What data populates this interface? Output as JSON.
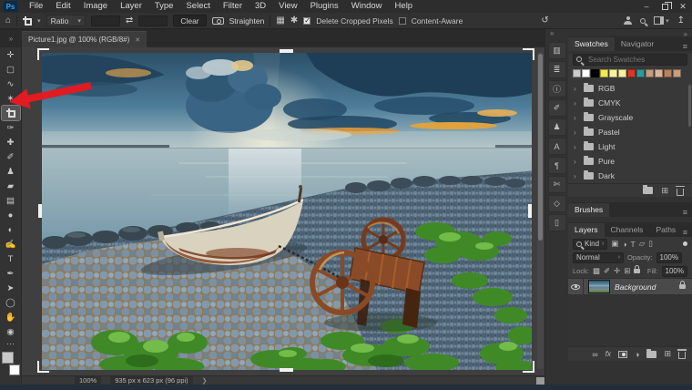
{
  "title_bar": {
    "logo": "Ps",
    "window_controls": {
      "minimize": "–",
      "restore": "",
      "close": "✕"
    }
  },
  "menu_bar": {
    "items": [
      "File",
      "Edit",
      "Image",
      "Layer",
      "Type",
      "Select",
      "Filter",
      "3D",
      "View",
      "Plugins",
      "Window",
      "Help"
    ]
  },
  "options_bar": {
    "home_icon": "⌂",
    "tool_caret": "▾",
    "ratio_value": "Ratio",
    "width_value": "",
    "swap_icon": "⇄",
    "height_value": "",
    "clear_label": "Clear",
    "straighten_label": "Straighten",
    "overlay_icon": "▦",
    "gear_icon": "✱",
    "delete_cropped_pixels_label": "Delete Cropped Pixels",
    "content_aware_label": "Content-Aware",
    "reset_icon": "↺",
    "share_icon": "↥"
  },
  "tab_bar": {
    "overflow_icon": "»",
    "doc_title": "Picture1.jpg @ 100% (RGB/8#)",
    "close_icon": "✕"
  },
  "toolbar": {
    "tools": [
      {
        "name": "move-tool",
        "glyph": "✛"
      },
      {
        "name": "marquee-tool",
        "glyph": "▢"
      },
      {
        "name": "lasso-tool",
        "glyph": "∿"
      },
      {
        "name": "quick-selection-tool",
        "glyph": "✶"
      },
      {
        "name": "crop-tool",
        "glyph": ""
      },
      {
        "name": "eyedropper-tool",
        "glyph": "✑"
      },
      {
        "name": "healing-brush-tool",
        "glyph": "✚"
      },
      {
        "name": "brush-tool",
        "glyph": "✐"
      },
      {
        "name": "clone-stamp-tool",
        "glyph": "♟"
      },
      {
        "name": "eraser-tool",
        "glyph": "▰"
      },
      {
        "name": "gradient-tool",
        "glyph": "▤"
      },
      {
        "name": "blur-tool",
        "glyph": "●"
      },
      {
        "name": "dodge-tool",
        "glyph": "◐"
      },
      {
        "name": "smudge-tool",
        "glyph": "✍"
      },
      {
        "name": "type-tool",
        "glyph": "T"
      },
      {
        "name": "pen-tool",
        "glyph": "✒"
      },
      {
        "name": "path-select-tool",
        "glyph": "➤"
      },
      {
        "name": "shape-tool",
        "glyph": "◯"
      },
      {
        "name": "hand-tool",
        "glyph": "✋"
      },
      {
        "name": "zoom-tool",
        "glyph": "◉"
      }
    ],
    "more_icon": "⋯"
  },
  "dock": {
    "collapse_icon": "«",
    "icons": [
      {
        "name": "histogram",
        "glyph": "▥"
      },
      {
        "name": "adjustments",
        "glyph": "≣"
      },
      {
        "name": "info",
        "glyph": "ⓘ"
      },
      {
        "name": "brush-settings",
        "glyph": "✐"
      },
      {
        "name": "clone-source",
        "glyph": "♟"
      },
      {
        "name": "character",
        "glyph": "A"
      },
      {
        "name": "paragraph",
        "glyph": "¶"
      },
      {
        "name": "libraries",
        "glyph": "✄"
      },
      {
        "name": "3d",
        "glyph": "◇"
      },
      {
        "name": "export",
        "glyph": "▯"
      }
    ]
  },
  "panels": {
    "expand_icon": "»",
    "menu_icon": "≡",
    "group_caret": "›",
    "swatches": {
      "tabs": [
        {
          "label": "Swatches"
        },
        {
          "label": "Navigator"
        }
      ],
      "search_placeholder": "Search Swatches",
      "colors": [
        "#c9c9c9",
        "#ffffff",
        "#000000",
        "#f3e94f",
        "#f7f1a0",
        "#f5efa6",
        "#dd3527",
        "#2f9a9e",
        "#c59b7d",
        "#d9b69a",
        "#b5835f",
        "#c79e80"
      ],
      "groups": [
        "RGB",
        "CMYK",
        "Grayscale",
        "Pastel",
        "Light",
        "Pure",
        "Dark"
      ],
      "new_icon": "⊞"
    },
    "brushes": {
      "tab_label": "Brushes"
    },
    "layers": {
      "tabs": [
        {
          "label": "Layers"
        },
        {
          "label": "Channels"
        },
        {
          "label": "Paths"
        }
      ],
      "kind_label": "Kind",
      "filter_icons": {
        "pixel": "▣",
        "adjustment": "◑",
        "type": "T",
        "shape": "▱",
        "smart": "▯"
      },
      "blend_mode": "Normal",
      "opacity_label": "Opacity:",
      "opacity_value": "100%",
      "lock_label": "Lock:",
      "lock_icons": {
        "transparent": "▩",
        "pixels": "✐",
        "position": "✛",
        "artboard": "⊞"
      },
      "fill_label": "Fill:",
      "fill_value": "100%",
      "rows": [
        {
          "name": "Background"
        }
      ],
      "footer": {
        "link": "∞",
        "fx": "fx",
        "adjustment": "◑",
        "new": "⊞"
      }
    }
  },
  "status_bar": {
    "zoom": "100%",
    "doc_info": "935 px x 623 px (96 ppi)",
    "flyout_icon": "❯"
  }
}
